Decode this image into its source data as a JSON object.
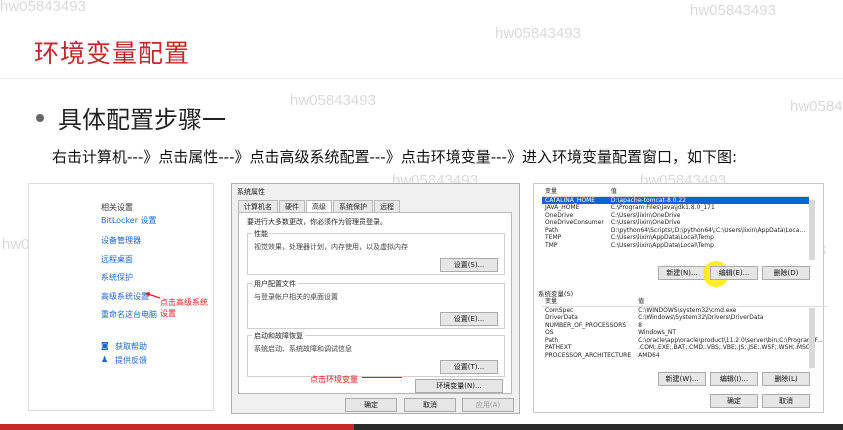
{
  "slide": {
    "title": "环境变量配置",
    "bullet": "具体配置步骤一",
    "description": "右击计算机---》点击属性---》点击高级系统配置---》点击环境变量---》进入环境变量配置窗口，如下图:",
    "watermark": "hw05843493",
    "accent_color": "#c0282c",
    "progress": 0.42
  },
  "panel1": {
    "header": "相关设置",
    "links": [
      "BitLocker 设置",
      "设备管理器",
      "远程桌面",
      "系统保护",
      "高级系统设置",
      "重命名这台电脑"
    ],
    "annotation": "点击高级系统设置",
    "help": "获取帮助",
    "feedback": "提供反馈"
  },
  "panel2": {
    "window_title": "系统属性",
    "tabs": [
      "计算机名",
      "硬件",
      "高级",
      "系统保护",
      "远程"
    ],
    "notice": "要进行大多数更改，你必须作为管理员登录。",
    "groups": [
      {
        "title": "性能",
        "desc": "视觉效果，处理器计划，内存使用，以及虚拟内存",
        "button": "设置(S)..."
      },
      {
        "title": "用户配置文件",
        "desc": "与登录帐户相关的桌面设置",
        "button": "设置(E)..."
      },
      {
        "title": "启动和故障恢复",
        "desc": "系统启动、系统故障和调试信息",
        "button": "设置(T)..."
      }
    ],
    "env_button": "环境变量(N)...",
    "annotation": "点击环境变量",
    "ok": "确定",
    "cancel": "取消",
    "apply": "应用(A)"
  },
  "panel3": {
    "user_vars_header": {
      "name": "变量",
      "value": "值"
    },
    "user_vars": [
      {
        "name": "CATALINA_HOME",
        "value": "D:\\apache-tomcat-8.0.22",
        "selected": true
      },
      {
        "name": "JAVA_HOME",
        "value": "C:\\Program Files\\Java\\jdk1.8.0_171"
      },
      {
        "name": "OneDrive",
        "value": "C:\\Users\\lixin\\OneDrive"
      },
      {
        "name": "OneDriveConsumer",
        "value": "C:\\Users\\lixin\\OneDrive"
      },
      {
        "name": "Path",
        "value": "D:\\python64\\Scripts\\;D:\\python64\\;C:\\Users\\lixin\\AppData\\Loca..."
      },
      {
        "name": "TEMP",
        "value": "C:\\Users\\lixin\\AppData\\Local\\Temp"
      },
      {
        "name": "TMP",
        "value": "C:\\Users\\lixin\\AppData\\Local\\Temp"
      }
    ],
    "user_buttons": [
      "新建(N)...",
      "编辑(E)...",
      "删除(D)"
    ],
    "sys_section": "系统变量(S)",
    "sys_vars_header": {
      "name": "变量",
      "value": "值"
    },
    "sys_vars": [
      {
        "name": "ComSpec",
        "value": "C:\\WINDOWS\\system32\\cmd.exe"
      },
      {
        "name": "DriverData",
        "value": "C:\\Windows\\System32\\Drivers\\DriverData"
      },
      {
        "name": "NUMBER_OF_PROCESSORS",
        "value": "8"
      },
      {
        "name": "OS",
        "value": "Windows_NT"
      },
      {
        "name": "Path",
        "value": "C:\\oracle\\app\\oracle\\product\\11.2.0\\server\\bin;C:\\Program F..."
      },
      {
        "name": "PATHEXT",
        "value": ".COM;.EXE;.BAT;.CMD;.VBS;.VBE;.JS;.JSE;.WSF;.WSH;.MSC"
      },
      {
        "name": "PROCESSOR_ARCHITECTURE",
        "value": "AMD64"
      }
    ],
    "sys_buttons": [
      "新建(W)...",
      "编辑(I)...",
      "删除(L)"
    ],
    "ok": "确定",
    "cancel": "取消"
  }
}
